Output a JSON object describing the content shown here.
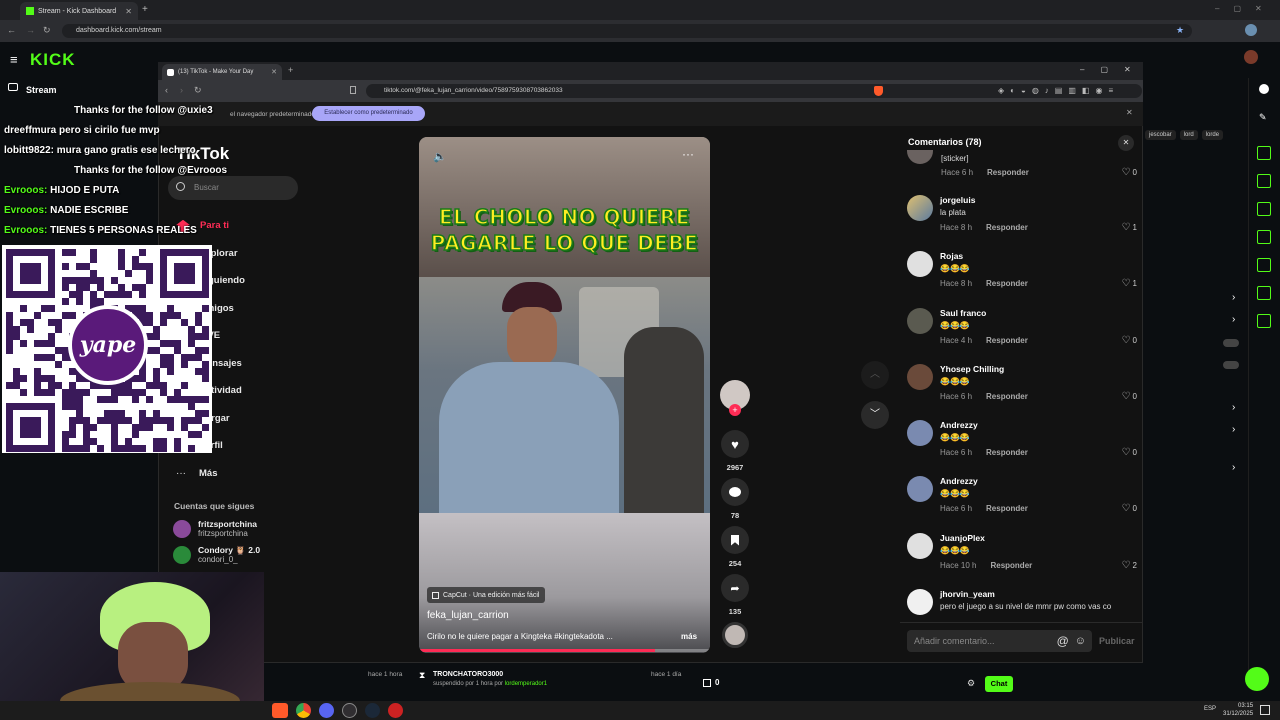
{
  "outer_browser": {
    "tab_title": "Stream - Kick Dashboard",
    "url": "dashboard.kick.com/stream"
  },
  "kick": {
    "logo": "KICK",
    "stream_label": "Stream",
    "bottom": {
      "left_time": "hace 1 hora",
      "raider_name": "TRONCHATORO3000",
      "raider_text_prefix": "suspendido por 1 hora por ",
      "raider_text_mod": "lordemperador1",
      "right_time": "hace 1 día",
      "viewer_count": "0",
      "chat_button": "Chat"
    },
    "tags": [
      "jescobar",
      "lord",
      "lorde"
    ]
  },
  "chat_overlay": [
    {
      "user": "",
      "text": "Thanks for the follow @uxie3"
    },
    {
      "user": "",
      "text": "dreeffmura pero si cirilo fue mvp"
    },
    {
      "user": "",
      "text": "lobitt9822: mura gano gratis ese lechero"
    },
    {
      "user": "",
      "text": "Thanks for the follow @Evrooos"
    },
    {
      "user": "Evrooos:",
      "text": "HIJOD E PUTA"
    },
    {
      "user": "Evrooos:",
      "text": "NADIE ESCRIBE"
    },
    {
      "user": "Evrooos:",
      "text": "TIENES 5 PERSONAS REALES"
    }
  ],
  "qr_logo": "yape",
  "tiktok_browser": {
    "tab_title": "(13) TikTok - Make Your Day",
    "url": "tiktok.com/@feka_lujan_carrion/video/7589759308703862033",
    "infobar_text": "el navegador predeterminado",
    "default_button": "Establecer como predeterminado"
  },
  "tiktok": {
    "logo": "TikTok",
    "search_placeholder": "Buscar",
    "nav": [
      "Para ti",
      "Explorar",
      "Siguiendo",
      "Amigos",
      "LIVE",
      "Mensajes",
      "Actividad",
      "Cargar",
      "Perfil",
      "Más"
    ],
    "following_title": "Cuentas que sigues",
    "following": [
      {
        "name": "fritzsportchina",
        "handle": "fritzsportchina"
      },
      {
        "name": "Condory 🦉 2.0",
        "handle": "condori_0_"
      }
    ],
    "video": {
      "caption_line1": "EL CHOLO NO QUIERE",
      "caption_line2": "PAGARLE LO QUE DEBE",
      "capcut": "CapCut · Una edición más fácil",
      "author": "feka_lujan_carrion",
      "description": "Cirilo no le quiere pagar a Kingteka #kingtekadota ...",
      "more": "más",
      "progress": 0.81
    },
    "actions": {
      "likes": "2967",
      "comments": "78",
      "saves": "254",
      "shares": "135"
    },
    "comments_title": "Comentarios (78)",
    "comments": [
      {
        "name": "",
        "text": "[sticker]",
        "time": "Hace 6 h",
        "reply": "Responder",
        "likes": "0"
      },
      {
        "name": "jorgeluis",
        "text": "la plata",
        "time": "Hace 8 h",
        "reply": "Responder",
        "likes": "1"
      },
      {
        "name": "Rojas",
        "text": "😂😂😂",
        "time": "Hace 8 h",
        "reply": "Responder",
        "likes": "1"
      },
      {
        "name": "Saul franco",
        "text": "😂😂😂",
        "time": "Hace 4 h",
        "reply": "Responder",
        "likes": "0"
      },
      {
        "name": "Yhosep Chilling",
        "text": "😂😂😂",
        "time": "Hace 6 h",
        "reply": "Responder",
        "likes": "0"
      },
      {
        "name": "Andrezzy",
        "text": "😂😂😂",
        "time": "Hace 6 h",
        "reply": "Responder",
        "likes": "0"
      },
      {
        "name": "Andrezzy",
        "text": "😂😂😂",
        "time": "Hace 6 h",
        "reply": "Responder",
        "likes": "0"
      },
      {
        "name": "JuanjoPlex",
        "text": "😂😂😂",
        "time": "Hace 10 h",
        "reply": "Responder",
        "likes": "2"
      },
      {
        "name": "jhorvin_yeam",
        "text": "pero el juego a su nivel de mmr pw como vas co",
        "time": "",
        "reply": "",
        "likes": ""
      }
    ],
    "comment_placeholder": "Añadir comentario...",
    "publish": "Publicar"
  },
  "taskbar": {
    "lang": "ESP",
    "time": "03:15",
    "date": "31/12/2025"
  },
  "colors": {
    "kick_green": "#53fc18",
    "tiktok_red": "#fe2c55",
    "caption_yellow": "#ffee22"
  }
}
